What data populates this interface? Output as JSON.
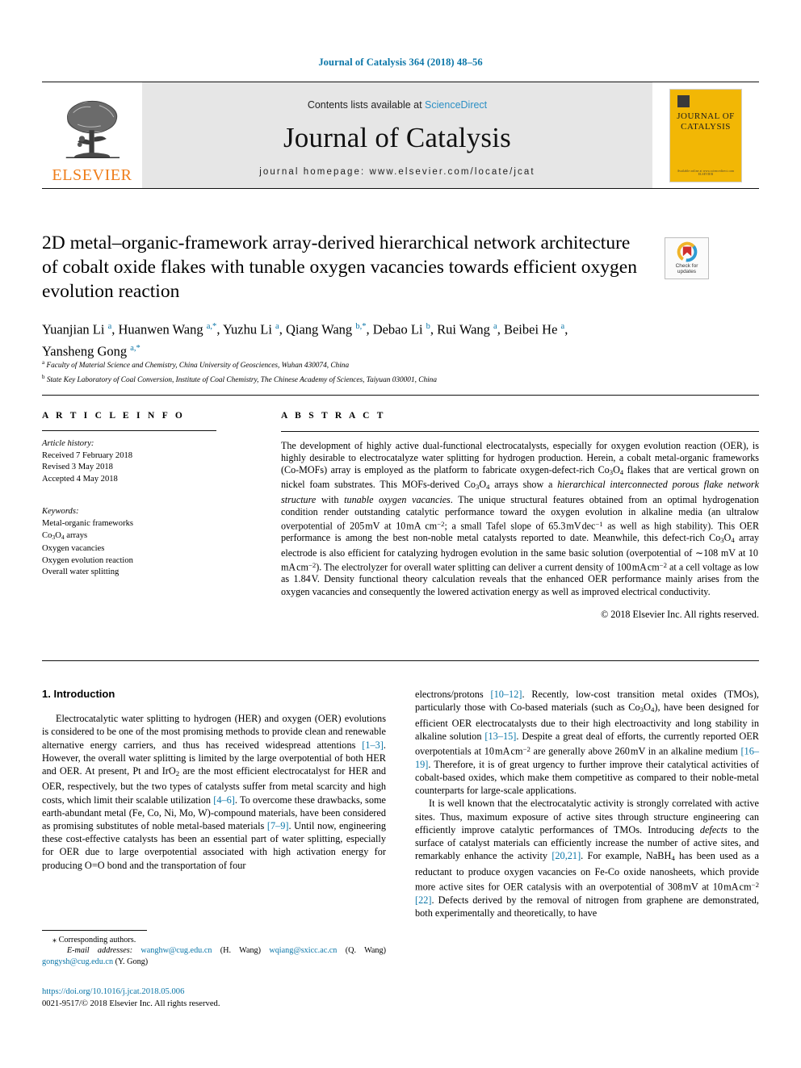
{
  "running_head": "Journal of Catalysis 364 (2018) 48–56",
  "masthead": {
    "publisher": "ELSEVIER",
    "contents_prefix": "Contents lists available at ",
    "contents_link": "ScienceDirect",
    "journal_title": "Journal of Catalysis",
    "homepage": "journal homepage: www.elsevier.com/locate/jcat",
    "cover_title": "JOURNAL OF\nCATALYSIS",
    "cover_footer": "Available online at www.sciencedirect.com\nELSEVIER"
  },
  "article": {
    "title": "2D metal–organic-framework array-derived hierarchical network architecture of cobalt oxide flakes with tunable oxygen vacancies towards efficient oxygen evolution reaction",
    "crossmark_label": "Check for\nupdates",
    "authors_html": "Yuanjian Li <sup>a</sup>, Huanwen Wang <sup>a,*</sup>, Yuzhu Li <sup>a</sup>, Qiang Wang <sup>b,*</sup>, Debao Li <sup>b</sup>, Rui Wang <sup>a</sup>, Beibei He <sup>a</sup>, Yansheng Gong <sup>a,*</sup>",
    "affiliation_a": "Faculty of Material Science and Chemistry, China University of Geosciences, Wuhan 430074, China",
    "affiliation_b": "State Key Laboratory of Coal Conversion, Institute of Coal Chemistry, The Chinese Academy of Sciences, Taiyuan 030001, China"
  },
  "article_info": {
    "heading": "A R T I C L E    I N F O",
    "history_label": "Article history:",
    "history": [
      "Received 7 February 2018",
      "Revised 3 May 2018",
      "Accepted 4 May 2018"
    ],
    "keywords_label": "Keywords:",
    "keywords": [
      "Metal-organic frameworks",
      "Co3O4 arrays",
      "Oxygen vacancies",
      "Oxygen evolution reaction",
      "Overall water splitting"
    ]
  },
  "abstract": {
    "heading": "A B S T R A C T",
    "body": "The development of highly active dual-functional electrocatalysts, especially for oxygen evolution reaction (OER), is highly desirable to electrocatalyze water splitting for hydrogen production. Herein, a cobalt metal-organic frameworks (Co-MOFs) array is employed as the platform to fabricate oxygen-defect-rich Co3O4 flakes that are vertical grown on nickel foam substrates. This MOFs-derived Co3O4 arrays show a hierarchical interconnected porous flake network structure with tunable oxygen vacancies. The unique structural features obtained from an optimal hydrogenation condition render outstanding catalytic performance toward the oxygen evolution in alkaline media (an ultralow overpotential of 205 mV at 10 mA cm−2; a small Tafel slope of 65.3 mV dec−1 as well as high stability). This OER performance is among the best non-noble metal catalysts reported to date. Meanwhile, this defect-rich Co3O4 array electrode is also efficient for catalyzing hydrogen evolution in the same basic solution (overpotential of ∼108 mV at 10 mA cm−2). The electrolyzer for overall water splitting can deliver a current density of 100 mA cm−2 at a cell voltage as low as 1.84 V. Density functional theory calculation reveals that the enhanced OER performance mainly arises from the oxygen vacancies and consequently the lowered activation energy as well as improved electrical conductivity.",
    "copyright": "© 2018 Elsevier Inc. All rights reserved."
  },
  "introduction": {
    "heading": "1. Introduction",
    "left_paragraph_1": "Electrocatalytic water splitting to hydrogen (HER) and oxygen (OER) evolutions is considered to be one of the most promising methods to provide clean and renewable alternative energy carriers, and thus has received widespread attentions [1–3]. However, the overall water splitting is limited by the large overpotential of both HER and OER. At present, Pt and IrO2 are the most efficient electrocatalyst for HER and OER, respectively, but the two types of catalysts suffer from metal scarcity and high costs, which limit their scalable utilization [4–6]. To overcome these drawbacks, some earth-abundant metal (Fe, Co, Ni, Mo, W)-compound materials, have been considered as promising substitutes of noble metal-based materials [7–9]. Until now, engineering these cost-effective catalysts has been an essential part of water splitting, especially for OER due to large overpotential associated with high activation energy for producing O=O bond and the transportation of four",
    "right_paragraph_1": "electrons/protons [10–12]. Recently, low-cost transition metal oxides (TMOs), particularly those with Co-based materials (such as Co3O4), have been designed for efficient OER electrocatalysts due to their high electroactivity and long stability in alkaline solution [13–15]. Despite a great deal of efforts, the currently reported OER overpotentials at 10 mA cm−2 are generally above 260 mV in an alkaline medium [16–19]. Therefore, it is of great urgency to further improve their catalytical activities of cobalt-based oxides, which make them competitive as compared to their noble-metal counterparts for large-scale applications.",
    "right_paragraph_2": "It is well known that the electrocatalytic activity is strongly correlated with active sites. Thus, maximum exposure of active sites through structure engineering can efficiently improve catalytic performances of TMOs. Introducing defects to the surface of catalyst materials can efficiently increase the number of active sites, and remarkably enhance the activity [20,21]. For example, NaBH4 has been used as a reductant to produce oxygen vacancies on Fe-Co oxide nanosheets, which provide more active sites for OER catalysis with an overpotential of 308 mV at 10 mA cm−2 [22]. Defects derived by the removal of nitrogen from graphene are demonstrated, both experimentally and theoretically, to have"
  },
  "footnotes": {
    "corresponding": "⁎ Corresponding authors.",
    "email_label": "E-mail addresses:",
    "emails": [
      {
        "address": "wanghw@cug.edu.cn",
        "owner": "(H. Wang)"
      },
      {
        "address": "wqiang@sxicc.ac.cn",
        "owner": "(Q. Wang)"
      },
      {
        "address": "gongysh@cug.edu.cn",
        "owner": "(Y. Gong)"
      }
    ],
    "doi": "https://doi.org/10.1016/j.jcat.2018.05.006",
    "issn_line": "0021-9517/© 2018 Elsevier Inc. All rights reserved."
  },
  "colors": {
    "link": "#0b76a8",
    "sciencedirect": "#2b8fc4",
    "elsevier_orange": "#ef7d1a",
    "cover_yellow": "#f2b705",
    "masthead_gray": "#e6e6e6"
  }
}
